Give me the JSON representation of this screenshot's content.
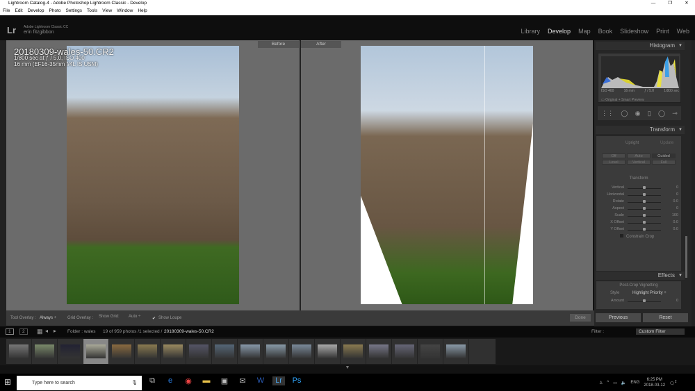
{
  "window": {
    "title": "Lightroom Catalog-4 - Adobe Photoshop Lightroom Classic - Develop",
    "controls": [
      "—",
      "❐",
      "✕"
    ]
  },
  "menu": [
    "File",
    "Edit",
    "Develop",
    "Photo",
    "Settings",
    "Tools",
    "View",
    "Window",
    "Help"
  ],
  "brand": {
    "logo": "Lr",
    "product": "Adobe Lightroom Classic CC",
    "user": "erin fitzgibbon"
  },
  "modules": [
    "Library",
    "Develop",
    "Map",
    "Book",
    "Slideshow",
    "Print",
    "Web"
  ],
  "active_module": "Develop",
  "view": {
    "before_label": "Before",
    "after_label": "After",
    "filename": "20180309-wales-50.CR2",
    "exposure": "1/800 sec at ƒ / 5.0, ISO 400",
    "lens": "16 mm (EF16-35mm f/4L IS USM)"
  },
  "histogram": {
    "title": "Histogram",
    "iso": "ISO 400",
    "focal": "16 mm",
    "aperture": "ƒ / 5.0",
    "shutter": "1/800 sec",
    "preview": "Original + Smart Preview"
  },
  "transform": {
    "title": "Transform",
    "upright": "Upright",
    "update": "Update",
    "buttons": [
      "Off",
      "Auto",
      "Guided",
      "Level",
      "Vertical",
      "Full"
    ],
    "section": "Transform",
    "sliders": [
      {
        "label": "Vertical",
        "value": "0"
      },
      {
        "label": "Horizontal",
        "value": "0"
      },
      {
        "label": "Rotate",
        "value": "0.0"
      },
      {
        "label": "Aspect",
        "value": "0"
      },
      {
        "label": "Scale",
        "value": "100"
      },
      {
        "label": "X Offset",
        "value": "0.0"
      },
      {
        "label": "Y Offset",
        "value": "0.0"
      }
    ],
    "constrain_crop": "Constrain Crop"
  },
  "effects": {
    "title": "Effects",
    "section": "Post-Crop Vignetting",
    "style_label": "Style",
    "style_value": "Highlight Priority ÷",
    "amount_label": "Amount",
    "amount_value": "0"
  },
  "panel_buttons": {
    "previous": "Previous",
    "reset": "Reset"
  },
  "toolbar": {
    "tool_overlay_label": "Tool Overlay :",
    "tool_overlay_value": "Always ÷",
    "grid_overlay_label": "Grid Overlay :",
    "show_grid": "Show Grid:",
    "grid_auto": "Auto ÷",
    "show_loupe": "Show Loupe",
    "done": "Done"
  },
  "filmstrip": {
    "page1": "1",
    "page2": "2",
    "folder": "Folder : wales",
    "count": "19 of 959 photos /1 selected /",
    "selected": "20180309-wales-50.CR2",
    "filter_label": "Filter :",
    "filter_value": "Custom Filter"
  },
  "taskbar": {
    "search_placeholder": "Type here to search",
    "lang": "ENG",
    "time": "6:25 PM",
    "date": "2018-03-12",
    "notifications": "2"
  }
}
